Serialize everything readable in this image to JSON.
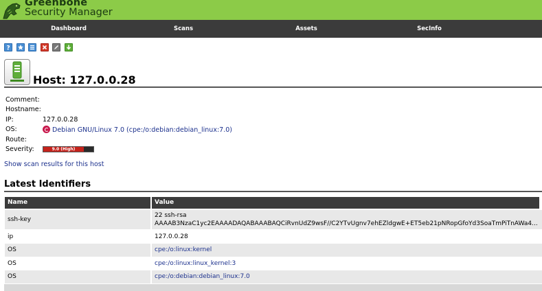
{
  "header": {
    "brand_line1": "Greenbone",
    "brand_line2": "Security Manager"
  },
  "nav": {
    "items": [
      {
        "label": "Dashboard"
      },
      {
        "label": "Scans"
      },
      {
        "label": "Assets"
      },
      {
        "label": "SecInfo"
      }
    ]
  },
  "toolbar": {
    "icons": [
      "help-icon",
      "new-icon",
      "list-icon",
      "delete-icon",
      "edit-icon",
      "export-icon"
    ]
  },
  "page": {
    "title": "Host: 127.0.0.28"
  },
  "details": {
    "comment_label": "Comment:",
    "comment_value": "",
    "hostname_label": "Hostname:",
    "hostname_value": "",
    "ip_label": "IP:",
    "ip_value": "127.0.0.28",
    "os_label": "OS:",
    "os_value": "Debian GNU/Linux 7.0 (cpe:/o:debian:debian_linux:7.0)",
    "route_label": "Route:",
    "route_value": "",
    "severity_label": "Severity:",
    "severity_value": "9.0 (High)",
    "severity_score": 9.0,
    "severity_color": "#c5231c"
  },
  "show_results_link": "Show scan results for this host",
  "identifiers": {
    "section_title": "Latest Identifiers",
    "columns": [
      "Name",
      "Value"
    ],
    "rows": [
      {
        "name": "ssh-key",
        "value_line1": "22 ssh-rsa",
        "value_line2": "AAAAB3NzaC1yc2EAAAADAQABAAABAQCiRvnUdZ9wsF//C2YTvUgnv7ehEZldgwE+ET5eb21pNRopGfoYd3SoaTmPiTnAWa4..."
      },
      {
        "name": "ip",
        "value_line1": "127.0.0.28",
        "value_line2": ""
      },
      {
        "name": "OS",
        "value_line1": "cpe:/o:linux:kernel",
        "value_line2": ""
      },
      {
        "name": "OS",
        "value_line1": "cpe:/o:linux:linux_kernel:3",
        "value_line2": ""
      },
      {
        "name": "OS",
        "value_line1": "cpe:/o:debian:debian_linux:7.0",
        "value_line2": ""
      }
    ]
  },
  "colors": {
    "header_green": "#8ccb48",
    "nav_bg": "#3b3b3b",
    "link": "#1a2f8c"
  }
}
